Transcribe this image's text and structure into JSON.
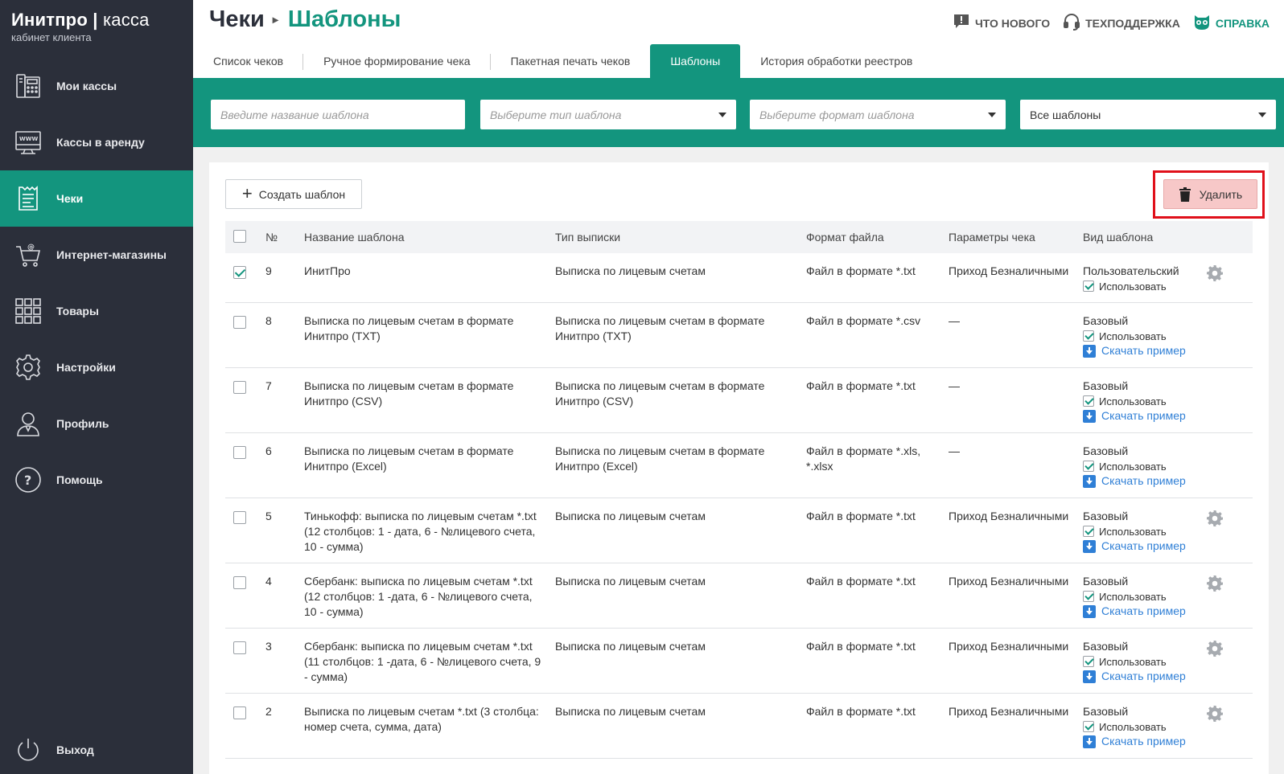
{
  "brand": {
    "name": "Инитпро",
    "product": "касса",
    "subtitle": "кабинет клиента"
  },
  "nav": [
    {
      "label": "Мои кассы",
      "icon": "cash-register-icon"
    },
    {
      "label": "Кассы в аренду",
      "icon": "www-monitor-icon"
    },
    {
      "label": "Чеки",
      "icon": "receipt-icon",
      "active": true
    },
    {
      "label": "Интернет-магазины",
      "icon": "shopping-cart-icon"
    },
    {
      "label": "Товары",
      "icon": "grid-icon"
    },
    {
      "label": "Настройки",
      "icon": "gear-icon"
    },
    {
      "label": "Профиль",
      "icon": "user-icon"
    },
    {
      "label": "Помощь",
      "icon": "help-icon"
    }
  ],
  "logout_label": "Выход",
  "header": {
    "crumb1": "Чеки",
    "crumb2": "Шаблоны",
    "links": {
      "news": "ЧТО НОВОГО",
      "support": "ТЕХПОДДЕРЖКА",
      "help": "СПРАВКА"
    }
  },
  "tabs": [
    "Список чеков",
    "Ручное формирование чека",
    "Пакетная печать чеков",
    "Шаблоны",
    "История обработки реестров"
  ],
  "active_tab": "Шаблоны",
  "filters": {
    "name_placeholder": "Введите название шаблона",
    "type_placeholder": "Выберите тип шаблона",
    "format_placeholder": "Выберите формат шаблона",
    "scope_value": "Все шаблоны"
  },
  "toolbar": {
    "create_label": "Создать шаблон",
    "delete_label": "Удалить"
  },
  "columns": {
    "num": "№",
    "name": "Название шаблона",
    "type": "Тип выписки",
    "format": "Формат файла",
    "params": "Параметры чека",
    "kind": "Вид шаблона"
  },
  "use_label": "Использовать",
  "download_label": "Скачать пример",
  "rows": [
    {
      "num": "9",
      "checked": true,
      "name": "ИнитПро",
      "type": "Выписка по лицевым счетам",
      "format": "Файл в формате *.txt",
      "params": "Приход Безналичными",
      "kind": "Пользовательский",
      "download": false,
      "gear": true
    },
    {
      "num": "8",
      "checked": false,
      "name": "Выписка по лицевым счетам в формате Инитпро (TXT)",
      "type": "Выписка по лицевым счетам в формате Инитпро (TXT)",
      "format": "Файл в формате *.csv",
      "params": "—",
      "kind": "Базовый",
      "download": true,
      "gear": false
    },
    {
      "num": "7",
      "checked": false,
      "name": "Выписка по лицевым счетам в формате Инитпро (CSV)",
      "type": "Выписка по лицевым счетам в формате Инитпро (CSV)",
      "format": "Файл в формате *.txt",
      "params": "—",
      "kind": "Базовый",
      "download": true,
      "gear": false
    },
    {
      "num": "6",
      "checked": false,
      "name": "Выписка по лицевым счетам в формате Инитпро (Excel)",
      "type": "Выписка по лицевым счетам в формате Инитпро (Excel)",
      "format": "Файл в формате *.xls, *.xlsx",
      "params": "—",
      "kind": "Базовый",
      "download": true,
      "gear": false
    },
    {
      "num": "5",
      "checked": false,
      "name": "Тинькофф: выписка по лицевым счетам *.txt (12 столбцов: 1 - дата, 6 - №лицевого счета, 10 - сумма)",
      "type": "Выписка по лицевым счетам",
      "format": "Файл в формате *.txt",
      "params": "Приход Безналичными",
      "kind": "Базовый",
      "download": true,
      "gear": true
    },
    {
      "num": "4",
      "checked": false,
      "name": "Сбербанк: выписка по лицевым счетам *.txt (12 столбцов: 1 -дата, 6 - №лицевого счета, 10 - сумма)",
      "type": "Выписка по лицевым счетам",
      "format": "Файл в формате *.txt",
      "params": "Приход Безналичными",
      "kind": "Базовый",
      "download": true,
      "gear": true
    },
    {
      "num": "3",
      "checked": false,
      "name": "Сбербанк: выписка по лицевым счетам *.txt (11 столбцов: 1 -дата, 6 - №лицевого счета, 9 - сумма)",
      "type": "Выписка по лицевым счетам",
      "format": "Файл в формате *.txt",
      "params": "Приход Безналичными",
      "kind": "Базовый",
      "download": true,
      "gear": true
    },
    {
      "num": "2",
      "checked": false,
      "name": "Выписка по лицевым счетам *.txt (3 столбца: номер счета, сумма, дата)",
      "type": "Выписка по лицевым счетам",
      "format": "Файл в формате *.txt",
      "params": "Приход Безналичными",
      "kind": "Базовый",
      "download": true,
      "gear": true
    }
  ],
  "colors": {
    "accent": "#13957e",
    "sidebar": "#2b2f3a",
    "delete_bg": "#f7c8c8",
    "highlight": "#e0101a",
    "link": "#2f7fd6"
  }
}
